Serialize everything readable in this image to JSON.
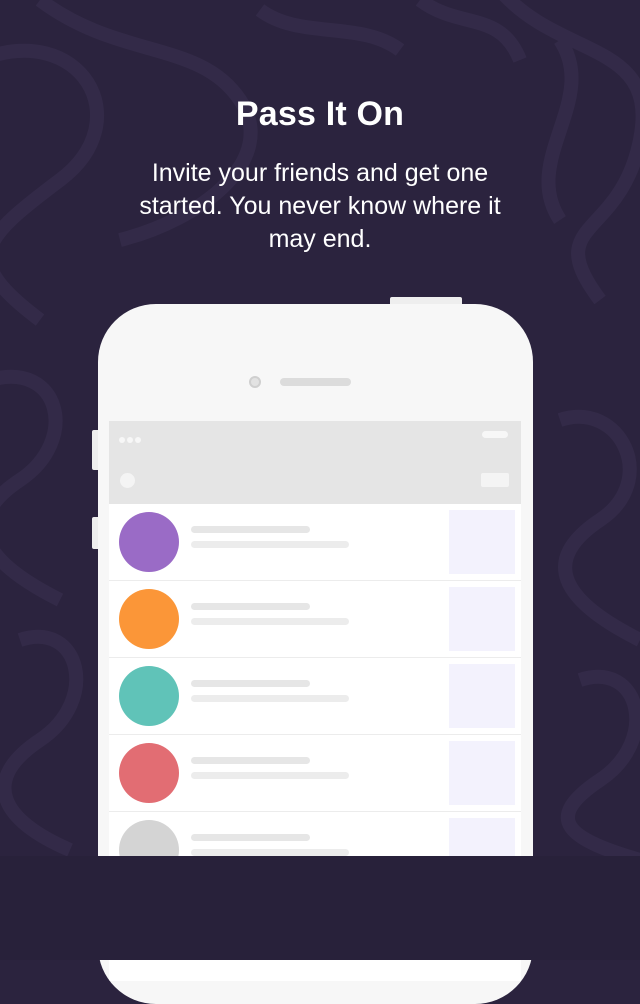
{
  "screen": {
    "headline": "Pass It On",
    "subtitle": "Invite your friends and get one started. You never know where it may end."
  },
  "colors": {
    "background": "#2b233e",
    "bottom_band": "#28213a",
    "avatars": [
      "#9a6bc6",
      "#fb9638",
      "#60c3b8",
      "#e26d73",
      "#d4d4d4"
    ]
  },
  "phone_mockup": {
    "rows": [
      {
        "avatar_color": "#9a6bc6"
      },
      {
        "avatar_color": "#fb9638"
      },
      {
        "avatar_color": "#60c3b8"
      },
      {
        "avatar_color": "#e26d73"
      },
      {
        "avatar_color": "#d4d4d4"
      }
    ]
  }
}
